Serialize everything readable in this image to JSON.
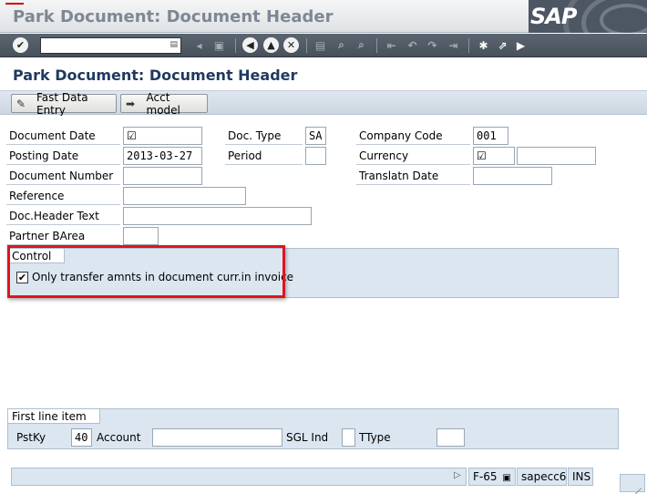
{
  "window": {
    "title": "Park Document: Document Header",
    "logo_text": "SAP"
  },
  "toolbar": {
    "command_value": "",
    "icons": [
      "enter-icon",
      "history-icon",
      "back-arrow-icon",
      "save-icon",
      "back-icon",
      "exit-icon",
      "cancel-icon",
      "print-icon",
      "find-icon",
      "find-next-icon",
      "first-page-icon",
      "previous-page-icon",
      "next-page-icon",
      "last-page-icon",
      "create-session-icon",
      "shortcut-icon",
      "help-icon"
    ]
  },
  "page": {
    "title": "Park Document: Document Header"
  },
  "app_toolbar": {
    "fast_data_entry_label": "Fast Data Entry",
    "acct_model_label": "Acct model"
  },
  "form": {
    "document_date": {
      "label": "Document Date",
      "value": "☑"
    },
    "posting_date": {
      "label": "Posting Date",
      "value": "2013-03-27"
    },
    "document_number": {
      "label": "Document Number",
      "value": ""
    },
    "reference": {
      "label": "Reference",
      "value": ""
    },
    "doc_header_text": {
      "label": "Doc.Header Text",
      "value": ""
    },
    "partner_barea": {
      "label": "Partner BArea",
      "value": ""
    },
    "doc_type": {
      "label": "Doc. Type",
      "value": "SA"
    },
    "period": {
      "label": "Period",
      "value": ""
    },
    "company_code": {
      "label": "Company Code",
      "value": "001"
    },
    "currency": {
      "label": "Currency",
      "value": "☑",
      "rate_value": ""
    },
    "translatn_date": {
      "label": "Translatn Date",
      "value": ""
    }
  },
  "control": {
    "title": "Control",
    "checkbox_label": "Only transfer amnts in document curr.in invoice",
    "checked": true
  },
  "first_line_item": {
    "title": "First line item",
    "pstky_label": "PstKy",
    "pstky_value": "40",
    "account_label": "Account",
    "account_value": "",
    "sgl_ind_label": "SGL Ind",
    "sgl_ind_value": "",
    "ttype_label": "TType",
    "ttype_value": ""
  },
  "status_bar": {
    "transaction": "F-65",
    "system": "sapecc6",
    "mode": "INS"
  },
  "colors": {
    "highlight": "#e0141e",
    "group_background": "#dbe6f1",
    "title_text": "#1f3a5f"
  }
}
